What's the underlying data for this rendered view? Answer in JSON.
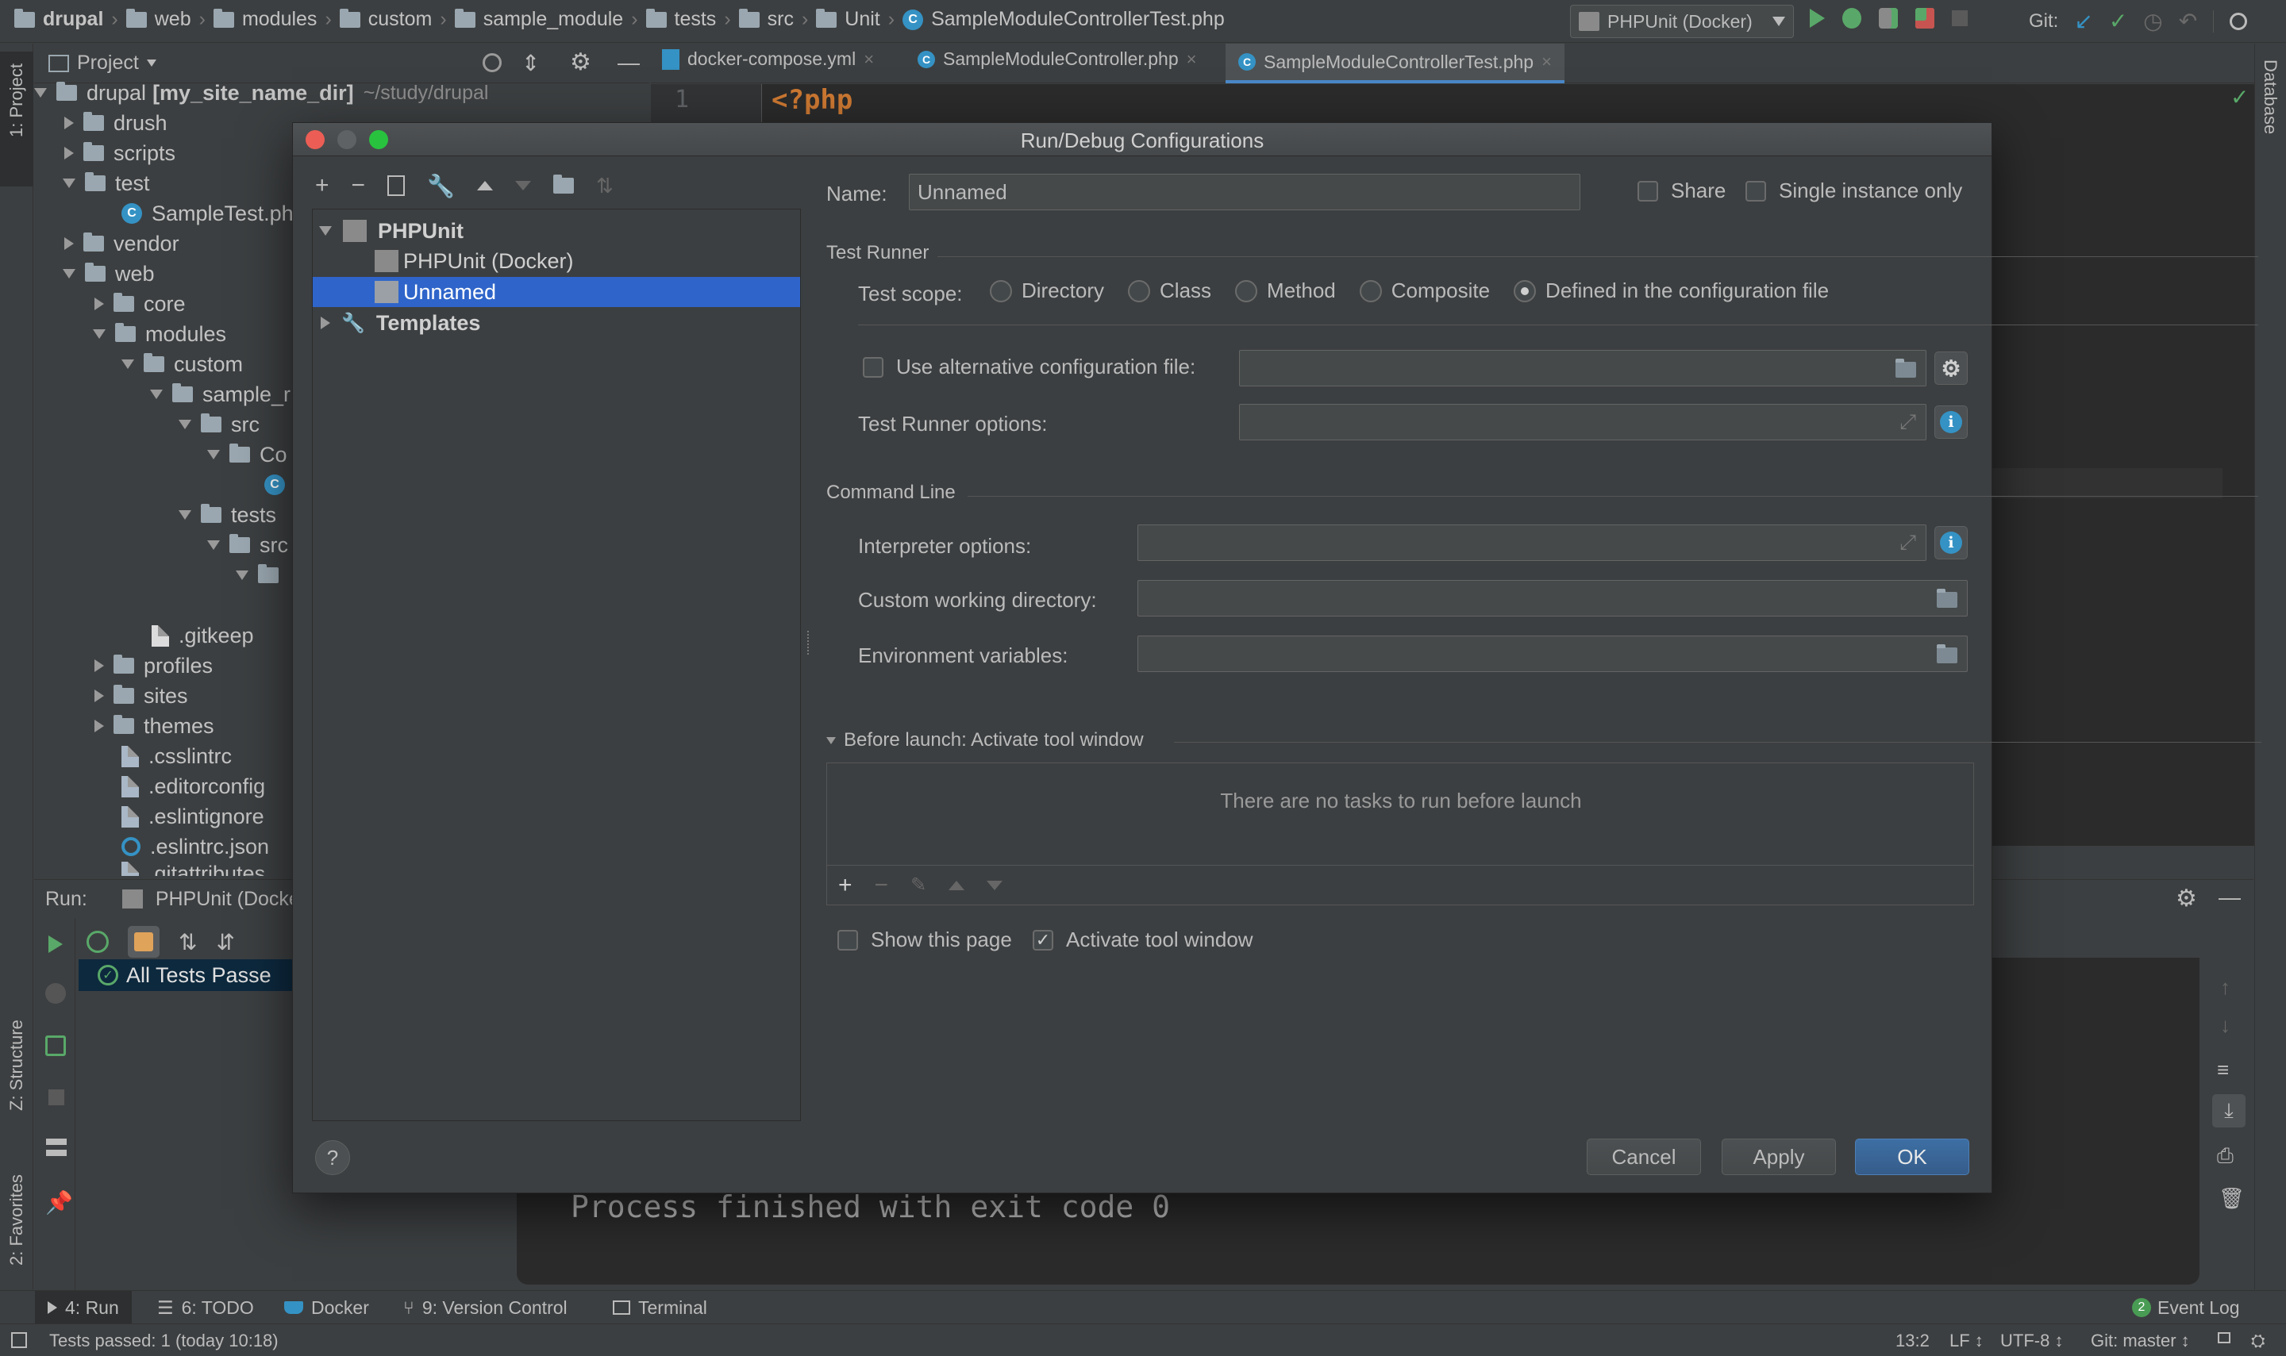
{
  "breadcrumbs": [
    "drupal",
    "web",
    "modules",
    "custom",
    "sample_module",
    "tests",
    "src",
    "Unit",
    "SampleModuleControllerTest.php"
  ],
  "toolbar": {
    "run_config": "PHPUnit (Docker)",
    "git_label": "Git:"
  },
  "left_stripe": {
    "project": "1: Project",
    "structure": "Z: Structure",
    "favorites": "2: Favorites"
  },
  "right_stripe": {
    "database": "Database"
  },
  "project_panel": {
    "title": "Project",
    "root_name": "drupal",
    "root_bold": "[my_site_name_dir]",
    "root_path": "~/study/drupal",
    "items": {
      "drush": "drush",
      "scripts": "scripts",
      "test": "test",
      "sampletest": "SampleTest.ph",
      "vendor": "vendor",
      "web": "web",
      "core": "core",
      "modules": "modules",
      "custom": "custom",
      "sample": "sample_r",
      "src": "src",
      "co": "Co",
      "tests": "tests",
      "src2": "src",
      "gitkeep": ".gitkeep",
      "profiles": "profiles",
      "sites": "sites",
      "themes": "themes",
      "csslintrc": ".csslintrc",
      "editorconfig": ".editorconfig",
      "eslintignore": ".eslintignore",
      "eslintrc": ".eslintrc.json",
      "gitattributes": ".gitattributes"
    }
  },
  "editor_tabs": [
    {
      "label": "docker-compose.yml"
    },
    {
      "label": "SampleModuleController.php"
    },
    {
      "label": "SampleModuleControllerTest.php"
    }
  ],
  "editor": {
    "line_no": "1",
    "code": "<?php"
  },
  "run_panel": {
    "label": "Run:",
    "tab": "PHPUnit (Docke",
    "result": "All Tests Passe",
    "process_line": "Process finished with exit code 0"
  },
  "dialog": {
    "title": "Run/Debug Configurations",
    "tree": {
      "phpunit": "PHPUnit",
      "phpunit_docker": "PHPUnit (Docker)",
      "unnamed": "Unnamed",
      "templates": "Templates"
    },
    "name_label": "Name:",
    "name_value": "Unnamed",
    "share": "Share",
    "single_instance": "Single instance only",
    "test_runner_title": "Test Runner",
    "test_scope_label": "Test scope:",
    "scopes": {
      "directory": "Directory",
      "class": "Class",
      "method": "Method",
      "composite": "Composite",
      "defined": "Defined in the configuration file"
    },
    "use_alt_config": "Use alternative configuration file:",
    "runner_options": "Test Runner options:",
    "command_line_title": "Command Line",
    "interpreter_options": "Interpreter options:",
    "working_dir": "Custom working directory:",
    "env_vars": "Environment variables:",
    "before_launch": "Before launch: Activate tool window",
    "no_tasks": "There are no tasks to run before launch",
    "show_page": "Show this page",
    "activate_tool": "Activate tool window",
    "help": "?",
    "cancel": "Cancel",
    "apply": "Apply",
    "ok": "OK"
  },
  "bottom_tabs": {
    "run": "4: Run",
    "todo": "6: TODO",
    "docker": "Docker",
    "vcs": "9: Version Control",
    "terminal": "Terminal",
    "event_log": "Event Log",
    "event_count": "2"
  },
  "status_bar": {
    "message": "Tests passed: 1 (today 10:18)",
    "position": "13:2",
    "line_sep": "LF ↕",
    "encoding": "UTF-8 ↕",
    "git": "Git: master ↕"
  },
  "colors": {
    "accent": "#3592c4",
    "selection": "#2f65ca",
    "green": "#59a869",
    "php_tag": "#cc7832"
  }
}
